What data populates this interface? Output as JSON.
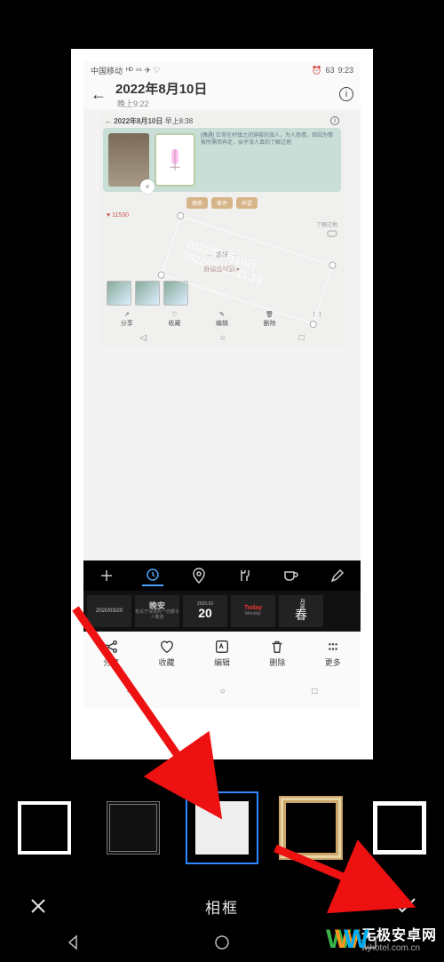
{
  "status": {
    "carrier": "中国移动",
    "icons": "ᴴᴰ ⁴⁶ ✈ ♡",
    "battery": "63",
    "time": "9:23"
  },
  "header": {
    "title": "2022年8月10日",
    "subtitle": "晚上9:22"
  },
  "nested": {
    "title": "2022年8月10日",
    "sub": "早上8:38",
    "desc": "[偶遇] 位常在村镇之间穿梭的旅人，为人热情，但因为情报所需而奔走，似乎没人真的了解过他",
    "chips": [
      "修炼",
      "事件",
      "声望"
    ],
    "hearts": "11530",
    "sub2": "了解过他",
    "tag": "喜好",
    "progress": "好感度奖励 ▸"
  },
  "watermark": {
    "line1": "2022年8月10日",
    "line2": "2022/08/10 21:19"
  },
  "miniToolbar": {
    "share": "分享",
    "fav": "收藏",
    "edit": "编辑",
    "del": "删除"
  },
  "templates": {
    "t1": "2020/03/20",
    "t2a": "晚安",
    "t2b": "有关于深夜的一切都令人着迷",
    "t3big": "20",
    "t3small": "2020.03",
    "t4a": "Today",
    "t4b": "Monday",
    "t5": "春",
    "t5b": "月夜"
  },
  "toolbar2": {
    "share": "分享",
    "fav": "收藏",
    "edit": "编辑",
    "del": "删除",
    "more": "更多"
  },
  "actionBar": {
    "label": "相框"
  },
  "logo": {
    "name": "无极安卓网",
    "domain": "wjhotel.com.cn"
  }
}
